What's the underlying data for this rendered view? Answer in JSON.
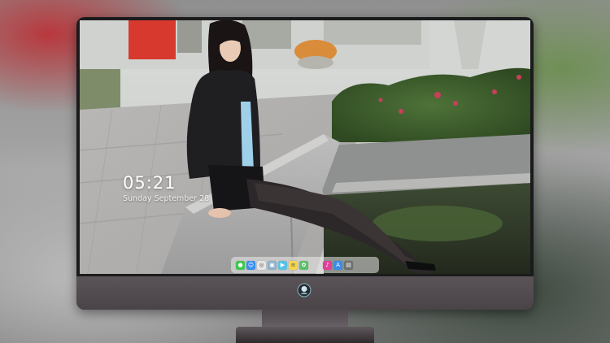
{
  "lock_screen": {
    "time": "05:21",
    "date": "Sunday September 28"
  },
  "dock": {
    "items": [
      {
        "icon": "messages-icon",
        "color": "#3fc84f",
        "glyph": "●"
      },
      {
        "icon": "finder-icon",
        "color": "#3a8ff0",
        "glyph": "☺"
      },
      {
        "icon": "safari-icon",
        "color": "#e8e8e8",
        "glyph": "◎"
      },
      {
        "icon": "preview-icon",
        "color": "#8fb0c9",
        "glyph": "▣"
      },
      {
        "icon": "video-icon",
        "color": "#59c1e6",
        "glyph": "▶"
      },
      {
        "icon": "notes-icon",
        "color": "#f5d54a",
        "glyph": "≡"
      },
      {
        "icon": "photos-icon",
        "color": "#5bc06a",
        "glyph": "✿"
      },
      {
        "icon": "music-icon",
        "color": "#e0409a",
        "glyph": "♪"
      },
      {
        "icon": "app-store-icon",
        "color": "#3b8de8",
        "glyph": "A"
      },
      {
        "icon": "trash-icon",
        "color": "#6f6f6f",
        "glyph": "▤"
      }
    ]
  },
  "colors": {
    "monitor_bezel": "#1b1b1d",
    "monitor_chin": "#544e52"
  }
}
